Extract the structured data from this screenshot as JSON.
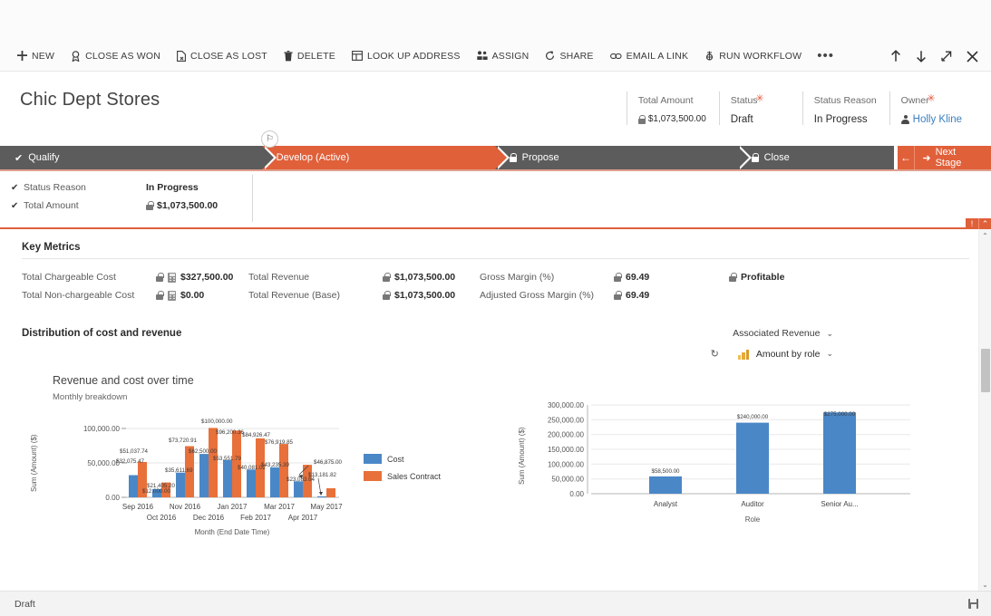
{
  "commandbar": {
    "commands": [
      {
        "icon": "plus-icon",
        "glyph": "✚",
        "label": "NEW"
      },
      {
        "icon": "ribbon-icon",
        "glyph": "🏅",
        "label": "CLOSE AS WON"
      },
      {
        "icon": "page-x-icon",
        "glyph": "🗋",
        "label": "CLOSE AS LOST"
      },
      {
        "icon": "trash-icon",
        "glyph": "🗑",
        "label": "DELETE"
      },
      {
        "icon": "grid-icon",
        "glyph": "▦",
        "label": "LOOK UP ADDRESS"
      },
      {
        "icon": "people-icon",
        "glyph": "👥",
        "label": "ASSIGN"
      },
      {
        "icon": "share-icon",
        "glyph": "↻",
        "label": "SHARE"
      },
      {
        "icon": "link-icon",
        "glyph": "⚯",
        "label": "EMAIL A LINK"
      },
      {
        "icon": "workflow-icon",
        "glyph": "⚙",
        "label": "RUN WORKFLOW"
      }
    ],
    "overflow_label": "•••",
    "right_buttons": [
      {
        "icon": "arrow-up-icon",
        "glyph": "↑",
        "name": "previous-record-button"
      },
      {
        "icon": "arrow-down-icon",
        "glyph": "↓",
        "name": "next-record-button"
      },
      {
        "icon": "popout-icon",
        "glyph": "⇗",
        "name": "pop-out-button"
      },
      {
        "icon": "close-icon",
        "glyph": "✕",
        "name": "close-button"
      }
    ]
  },
  "record": {
    "title": "Chic Dept Stores",
    "header_fields": [
      {
        "label": "Total Amount",
        "value": "$1,073,500.00",
        "required": false,
        "locked": true,
        "link": false,
        "person": false
      },
      {
        "label": "Status",
        "value": "Draft",
        "required": true,
        "locked": false,
        "link": false,
        "person": false
      },
      {
        "label": "Status Reason",
        "value": "In Progress",
        "required": false,
        "locked": false,
        "link": false,
        "person": false
      },
      {
        "label": "Owner",
        "value": "Holly Kline",
        "required": true,
        "locked": false,
        "link": true,
        "person": true
      }
    ]
  },
  "process_flow": {
    "stages": [
      {
        "label": "Qualify",
        "state": "done"
      },
      {
        "label": "Develop (Active)",
        "state": "active"
      },
      {
        "label": "Propose",
        "state": "locked"
      },
      {
        "label": "Close",
        "state": "locked"
      }
    ],
    "back_glyph": "←",
    "next_label": "Next Stage",
    "next_glyph": "➜",
    "flag_glyph": "⚐"
  },
  "stage_detail": {
    "rows": [
      {
        "name": "Status Reason",
        "value": "In Progress",
        "locked": false
      },
      {
        "name": "Total Amount",
        "value": "$1,073,500.00",
        "locked": true
      }
    ]
  },
  "collapse_tab": {
    "info_glyph": "!",
    "chevron_glyph": "⌃"
  },
  "key_metrics": {
    "title": "Key Metrics",
    "items": [
      {
        "label": "Total Chargeable Cost",
        "value": "$327,500.00",
        "locked": true,
        "calc": true
      },
      {
        "label": "Total Revenue",
        "value": "$1,073,500.00",
        "locked": true,
        "calc": false
      },
      {
        "label": "Gross Margin (%)",
        "value": "69.49",
        "locked": true,
        "calc": false
      },
      {
        "label": "Profitable",
        "value": "",
        "locked": true,
        "calc": false,
        "label_bold": true
      },
      {
        "label": "Total Non-chargeable Cost",
        "value": "$0.00",
        "locked": true,
        "calc": true
      },
      {
        "label": "Total Revenue (Base)",
        "value": "$1,073,500.00",
        "locked": true,
        "calc": false
      },
      {
        "label": "Adjusted Gross Margin (%)",
        "value": "69.49",
        "locked": true,
        "calc": false
      },
      {
        "label": "",
        "value": "",
        "locked": false,
        "calc": false
      }
    ]
  },
  "charts_section": {
    "title": "Distribution of cost and revenue",
    "view_selector": "Associated Revenue",
    "view_chevron": "⌄",
    "chart_selector": "Amount by role",
    "chart_chevron": "⌄",
    "refresh_glyph": "↻",
    "chart_icon": "bar-chart-icon"
  },
  "chart_data": [
    {
      "type": "bar",
      "id": "revenue-and-cost-over-time",
      "title": "Revenue and cost over time",
      "subtitle": "Monthly breakdown",
      "xlabel": "Month (End Date Time)",
      "ylabel": "Sum (Amount) ($)",
      "ylim": [
        0,
        125000
      ],
      "yticks": [
        0,
        50000,
        100000
      ],
      "ytick_labels": [
        "0.00",
        "50,000.00",
        "100,000.00"
      ],
      "grid": true,
      "legend_position": "right",
      "categories": [
        "Sep 2016",
        "Oct 2016",
        "Nov 2016",
        "Dec 2016",
        "Jan 2017",
        "Feb 2017",
        "Mar 2017",
        "Apr 2017",
        "May 2017"
      ],
      "series": [
        {
          "name": "Cost",
          "color": "#4a87c7",
          "values": [
            32075.47,
            12000.0,
            35611.69,
            62500.0,
            53551.79,
            40081.02,
            43235.39,
            23083.64,
            1500.0
          ],
          "labels": [
            "$32,075.47",
            "$12,000.00",
            "$35,611.69",
            "$62,500.00",
            "$53,551.79",
            "$40,081.02",
            "$43,235.39",
            "$23,083.64",
            ""
          ]
        },
        {
          "name": "Sales Contract",
          "color": "#e8703a",
          "values": [
            51037.74,
            21405.2,
            73720.91,
            100000.0,
            96200.36,
            84926.47,
            76919.85,
            46875.0,
            13181.82
          ],
          "labels": [
            "$51,037.74",
            "$21,405.20",
            "$73,720.91",
            "$100,000.00",
            "$96,200.36",
            "$84,926.47",
            "$76,919.85",
            "$46,875.00",
            "$13,181.82"
          ]
        }
      ],
      "annotations": [
        {
          "text": "$46,875.00",
          "target": "Apr 2017 Sales Contract"
        },
        {
          "text": "$100,000.00",
          "target": "Dec 2016 Sales Contract"
        }
      ]
    },
    {
      "type": "bar",
      "id": "amount-by-role",
      "title": "Amount by role",
      "xlabel": "Role",
      "ylabel": "Sum (Amount) ($)",
      "ylim": [
        0,
        300000
      ],
      "yticks": [
        0,
        50000,
        100000,
        150000,
        200000,
        250000,
        300000
      ],
      "ytick_labels": [
        "0.00",
        "50,000.00",
        "100,000.00",
        "150,000.00",
        "200,000.00",
        "250,000.00",
        "300,000.00"
      ],
      "grid": true,
      "categories": [
        "Analyst",
        "Auditor",
        "Senior Au..."
      ],
      "values": [
        58500.0,
        240000.0,
        275000.0
      ],
      "value_labels": [
        "$58,500.00",
        "$240,000.00",
        "$275,000.00"
      ],
      "bar_color": "#4a87c7"
    }
  ],
  "statusbar": {
    "text": "Draft",
    "save_icon": "save-icon"
  },
  "scrollbar": {
    "up_glyph": "⌃",
    "down_glyph": "⌄"
  },
  "colors": {
    "accent": "#e0603a",
    "stage_done": "#5c5c5c",
    "cost_series": "#4a87c7",
    "sales_series": "#e8703a",
    "link": "#3b7fbf"
  }
}
